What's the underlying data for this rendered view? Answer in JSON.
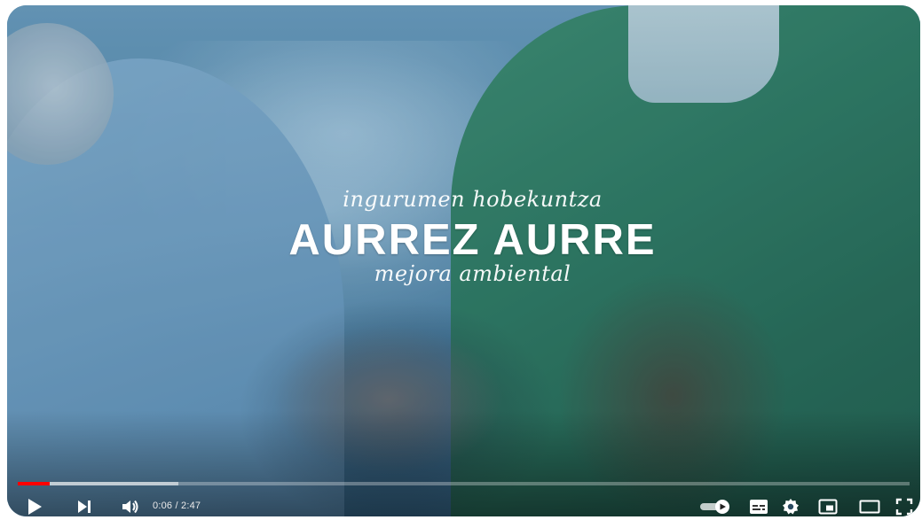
{
  "overlay": {
    "top_line": "ingurumen hobekuntza",
    "title": "AURREZ AURRE",
    "bottom_line": "mejora ambiental"
  },
  "player": {
    "current_time": "0:06",
    "separator": "/",
    "duration": "2:47",
    "progress_played_fraction": 0.036,
    "progress_loaded_fraction": 0.18,
    "accent_color": "#ff0000",
    "autoplay_on": true
  },
  "controls": {
    "left": [
      "play-icon",
      "next-icon",
      "volume-icon"
    ],
    "right": [
      "autoplay-toggle-icon",
      "subtitles-icon",
      "settings-icon",
      "miniplayer-icon",
      "theater-mode-icon",
      "fullscreen-icon"
    ]
  }
}
